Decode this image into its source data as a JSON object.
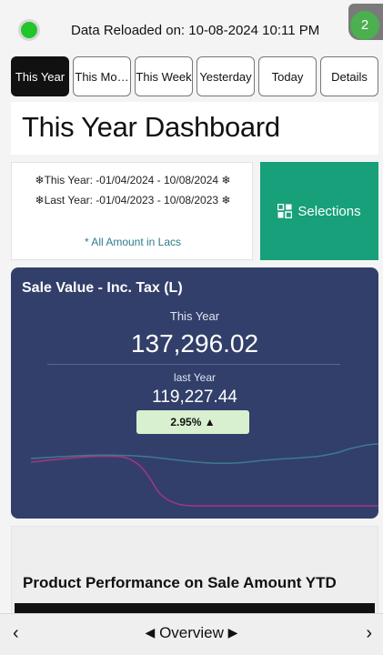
{
  "status": {
    "indicator_color": "#22c52a",
    "reload_text": "Data Reloaded on: 10-08-2024 10:11 PM",
    "notification_count": "2"
  },
  "tabs": [
    {
      "label": "This Year",
      "active": true
    },
    {
      "label": "This Mo…",
      "active": false
    },
    {
      "label": "This Week",
      "active": false
    },
    {
      "label": "Yesterday",
      "active": false
    },
    {
      "label": "Today",
      "active": false
    },
    {
      "label": "Details",
      "active": false
    }
  ],
  "page_title": "This Year Dashboard",
  "period": {
    "this_year": "❄This Year: -01/04/2024 - 10/08/2024 ❄",
    "last_year": "❄Last Year: -01/04/2023 - 10/08/2023 ❄",
    "note": "* All Amount in Lacs"
  },
  "selections": {
    "label": "Selections",
    "icon": "selections-grid-icon",
    "color": "#17a07a"
  },
  "kpi": {
    "title": "Sale Value - Inc. Tax (L)",
    "this_year_label": "This Year",
    "this_year_value": "137,296.02",
    "last_year_label": "last Year",
    "last_year_value": "119,227.44",
    "delta": "2.95% ▲",
    "background": "#323f6b"
  },
  "product_performance": {
    "title": "Product Performance on Sale Amount YTD"
  },
  "navigation": {
    "prev": "‹",
    "next": "›",
    "sheet_left_arrow": "◀",
    "sheet_name": "Overview",
    "sheet_right_arrow": "▶"
  }
}
